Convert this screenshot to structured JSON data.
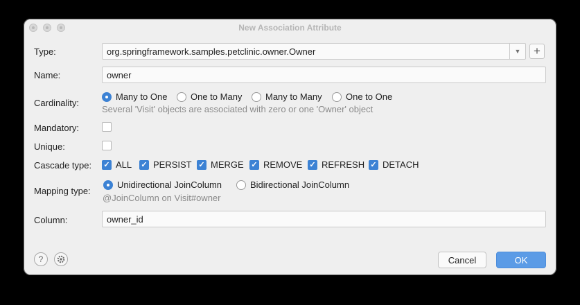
{
  "window": {
    "title": "New Association Attribute"
  },
  "form": {
    "type_label": "Type:",
    "type_value": "org.springframework.samples.petclinic.owner.Owner",
    "name_label": "Name:",
    "name_value": "owner",
    "cardinality_label": "Cardinality:",
    "cardinality_options": [
      "Many to One",
      "One to Many",
      "Many to Many",
      "One to One"
    ],
    "cardinality_selected": "Many to One",
    "cardinality_hint": "Several 'Visit' objects are associated with zero or one 'Owner' object",
    "mandatory_label": "Mandatory:",
    "mandatory_checked": false,
    "unique_label": "Unique:",
    "unique_checked": false,
    "cascade_label": "Cascade type:",
    "cascade_options": [
      "ALL",
      "PERSIST",
      "MERGE",
      "REMOVE",
      "REFRESH",
      "DETACH"
    ],
    "mapping_label": "Mapping type:",
    "mapping_options": [
      "Unidirectional JoinColumn",
      "Bidirectional JoinColumn"
    ],
    "mapping_selected": "Unidirectional JoinColumn",
    "mapping_hint": "@JoinColumn on Visit#owner",
    "column_label": "Column:",
    "column_value": "owner_id"
  },
  "footer": {
    "help_icon": "?",
    "cancel_label": "Cancel",
    "ok_label": "OK"
  },
  "colors": {
    "accent": "#3c82d4",
    "ok_button": "#5b9be6"
  }
}
